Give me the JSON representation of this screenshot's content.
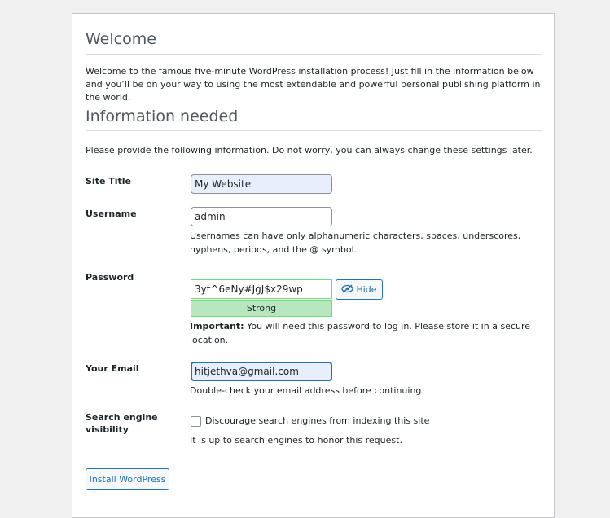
{
  "welcome": {
    "title": "Welcome",
    "intro": "Welcome to the famous five-minute WordPress installation process! Just fill in the information below and you’ll be on your way to using the most extendable and powerful personal publishing platform in the world."
  },
  "info": {
    "title": "Information needed",
    "intro": "Please provide the following information. Do not worry, you can always change these settings later."
  },
  "fields": {
    "site_title": {
      "label": "Site Title",
      "value": "My Website"
    },
    "username": {
      "label": "Username",
      "value": "admin",
      "desc": "Usernames can have only alphanumeric characters, spaces, underscores, hyphens, periods, and the @ symbol."
    },
    "password": {
      "label": "Password",
      "value": "3yt^6eNy#JgJ$x29wp",
      "hide_label": "Hide",
      "strength": "Strong",
      "important_prefix": "Important:",
      "important_text": " You will need this password to log in. Please store it in a secure location."
    },
    "email": {
      "label": "Your Email",
      "value": "hitjethva@gmail.com",
      "desc": "Double-check your email address before continuing."
    },
    "search": {
      "label": "Search engine visibility",
      "checkbox_label": "Discourage search engines from indexing this site",
      "desc": "It is up to search engines to honor this request."
    }
  },
  "install_button": "Install WordPress",
  "colors": {
    "accent": "#2271b1",
    "strength_bg": "#b8e6bf",
    "strength_border": "#68de7c"
  },
  "icons": {
    "hide": "eye-slash-icon"
  }
}
